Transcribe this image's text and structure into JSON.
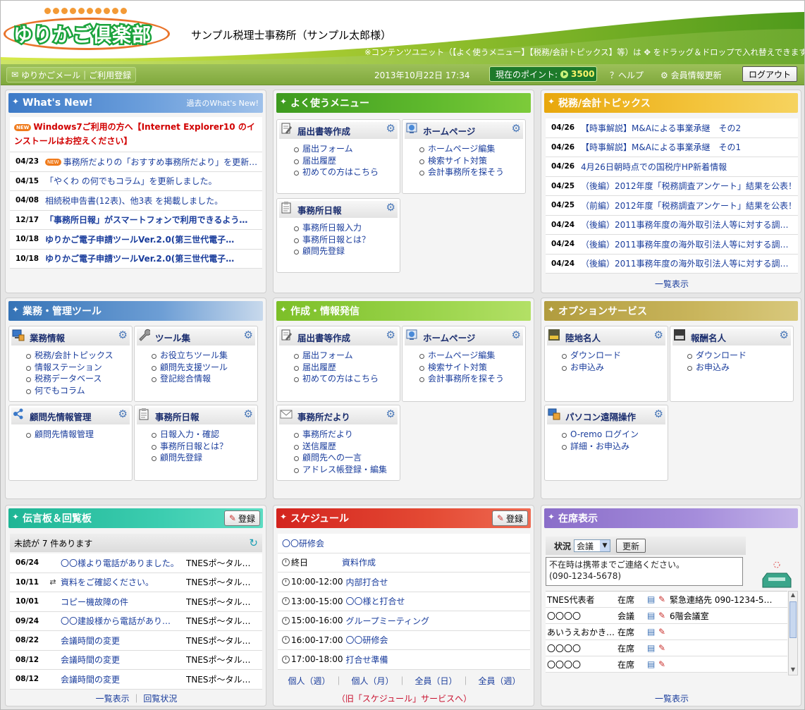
{
  "header": {
    "logo_text": "ゆりかご倶楽部",
    "office": "サンプル税理士事務所（サンプル太郎様）",
    "hint": "※コンテンツユニット（【よく使うメニュー】【税務/会計トピックス】等）は ✥ をドラッグ＆ドロップで入れ替えできます。"
  },
  "bar": {
    "mail": "ゆりかごメール",
    "register": "ご利用登録",
    "date": "2013年10月22日 17:34",
    "points_label": "現在のポイント:",
    "points": "3500",
    "help": "ヘルプ",
    "account": "会員情報更新",
    "logout": "ログアウト"
  },
  "whatsnew": {
    "title": "What's New!",
    "past": "過去のWhat's New!",
    "new_badge": "NEW",
    "headline": "Windows7ご利用の方へ【Internet Explorer10 のインストールはお控えください】",
    "items": [
      {
        "date": "04/23",
        "text": "事務所だよりの「おすすめ事務所だより」を更新…",
        "badge": true
      },
      {
        "date": "04/15",
        "text": "「やくわ の何でもコラム」を更新しました。"
      },
      {
        "date": "04/08",
        "text": "相続税申告書(12表)、他3表 を掲載しました。"
      },
      {
        "date": "12/17",
        "text": "「事務所日報」がスマートフォンで利用できるよう…",
        "strong": true
      },
      {
        "date": "10/18",
        "text": "ゆりかご電子申請ツールVer.2.0(第三世代電子…",
        "strong": true
      },
      {
        "date": "10/18",
        "text": "ゆりかご電子申請ツールVer.2.0(第三世代電子…",
        "strong": true
      }
    ]
  },
  "menu": {
    "title": "よく使うメニュー",
    "cards": [
      {
        "title": "届出書等作成",
        "items": [
          "届出フォーム",
          "届出履歴",
          "初めての方はこちら"
        ]
      },
      {
        "title": "ホームページ",
        "items": [
          "ホームページ編集",
          "検索サイト対策",
          "会計事務所を探そう"
        ]
      },
      {
        "title": "事務所日報",
        "items": [
          "事務所日報入力",
          "事務所日報とは？",
          "顧問先登録"
        ]
      }
    ]
  },
  "topics": {
    "title": "税務/会計トピックス",
    "more": "一覧表示",
    "items": [
      {
        "date": "04/26",
        "text": "【時事解説】M&Aによる事業承継　その2"
      },
      {
        "date": "04/26",
        "text": "【時事解説】M&Aによる事業承継　その1"
      },
      {
        "date": "04/26",
        "text": "4月26日朝時点での国税庁HP新着情報"
      },
      {
        "date": "04/25",
        "text": "（後編）2012年度「税務調査アンケート」結果を公表！"
      },
      {
        "date": "04/25",
        "text": "（前編）2012年度「税務調査アンケート」結果を公表！"
      },
      {
        "date": "04/24",
        "text": "（後編）2011事務年度の海外取引法人等に対する調…"
      },
      {
        "date": "04/24",
        "text": "（後編）2011事務年度の海外取引法人等に対する調…"
      },
      {
        "date": "04/24",
        "text": "（後編）2011事務年度の海外取引法人等に対する調…"
      }
    ]
  },
  "tools": {
    "title": "業務・管理ツール",
    "cards": [
      {
        "title": "業務情報",
        "items": [
          "税務/会計トピックス",
          "情報ステーション",
          "税務データベース",
          "何でもコラム"
        ]
      },
      {
        "title": "ツール集",
        "items": [
          "お役立ちツール集",
          "顧問先支援ツール",
          "登記総合情報"
        ]
      },
      {
        "title": "顧問先情報管理",
        "items": [
          "顧問先情報管理"
        ]
      },
      {
        "title": "事務所日報",
        "items": [
          "日報入力・確認",
          "事務所日報とは？",
          "顧問先登録"
        ]
      }
    ]
  },
  "create": {
    "title": "作成・情報発信",
    "cards": [
      {
        "title": "届出書等作成",
        "items": [
          "届出フォーム",
          "届出履歴",
          "初めての方はこちら"
        ]
      },
      {
        "title": "ホームページ",
        "items": [
          "ホームページ編集",
          "検索サイト対策",
          "会計事務所を探そう"
        ]
      },
      {
        "title": "事務所だより",
        "items": [
          "事務所だより",
          "送信履歴",
          "顧問先への一言",
          "アドレス帳登録・編集"
        ]
      }
    ]
  },
  "options": {
    "title": "オプションサービス",
    "cards": [
      {
        "title": "陸地名人",
        "items": [
          "ダウンロード",
          "お申込み"
        ]
      },
      {
        "title": "報酬名人",
        "items": [
          "ダウンロード",
          "お申込み"
        ]
      },
      {
        "title": "パソコン遠隔操作",
        "items": [
          "O-remo ログイン",
          "詳細・お申込み"
        ]
      }
    ]
  },
  "board": {
    "title": "伝言板＆回覧板",
    "register": "登録",
    "unread": "未読が 7 件あります",
    "list": "一覧表示",
    "status": "回覧状況",
    "items": [
      {
        "date": "06/24",
        "text": "〇〇様より電話がありました。",
        "from": "TNESポ～タル…"
      },
      {
        "date": "10/11",
        "text": "資料をご確認ください。",
        "from": "TNESポ～タル…"
      },
      {
        "date": "10/01",
        "text": "コピー機故障の件",
        "from": "TNESポ～タル…"
      },
      {
        "date": "09/24",
        "text": "〇〇建設様から電話があり…",
        "from": "TNESポ～タル…"
      },
      {
        "date": "08/22",
        "text": "会議時間の変更",
        "from": "TNESポ～タル…"
      },
      {
        "date": "08/12",
        "text": "会議時間の変更",
        "from": "TNESポ～タル…"
      },
      {
        "date": "08/12",
        "text": "会議時間の変更",
        "from": "TNESポ～タル…"
      }
    ]
  },
  "schedule": {
    "title": "スケジュール",
    "register": "登録",
    "top": "〇〇研修会",
    "items": [
      {
        "time": "終日",
        "text": "資料作成"
      },
      {
        "time": "10:00-12:00",
        "text": "内部打合せ"
      },
      {
        "time": "13:00-15:00",
        "text": "〇〇様と打合せ"
      },
      {
        "time": "15:00-16:00",
        "text": "グループミーティング"
      },
      {
        "time": "16:00-17:00",
        "text": "〇〇研修会"
      },
      {
        "time": "17:00-18:00",
        "text": "打合せ準備"
      }
    ],
    "links": [
      "個人（週）",
      "個人（月）",
      "全員（日）",
      "全員（週）"
    ],
    "old": "（旧「スケジュール」サービスへ）"
  },
  "presence": {
    "title": "在席表示",
    "status_label": "状況",
    "status_value": "会議",
    "update": "更新",
    "message": "不在時は携帯までご連絡ください。\n(090-1234-5678)",
    "more": "一覧表示",
    "items": [
      {
        "name": "TNES代表者",
        "state": "在席",
        "note": "緊急連絡先 090-1234-5…"
      },
      {
        "name": "〇〇〇〇",
        "state": "会議",
        "note": "6階会議室"
      },
      {
        "name": "あいうえおかき…",
        "state": "在席",
        "note": ""
      },
      {
        "name": "〇〇〇〇",
        "state": "在席",
        "note": ""
      },
      {
        "name": "〇〇〇〇",
        "state": "在席",
        "note": ""
      }
    ]
  }
}
